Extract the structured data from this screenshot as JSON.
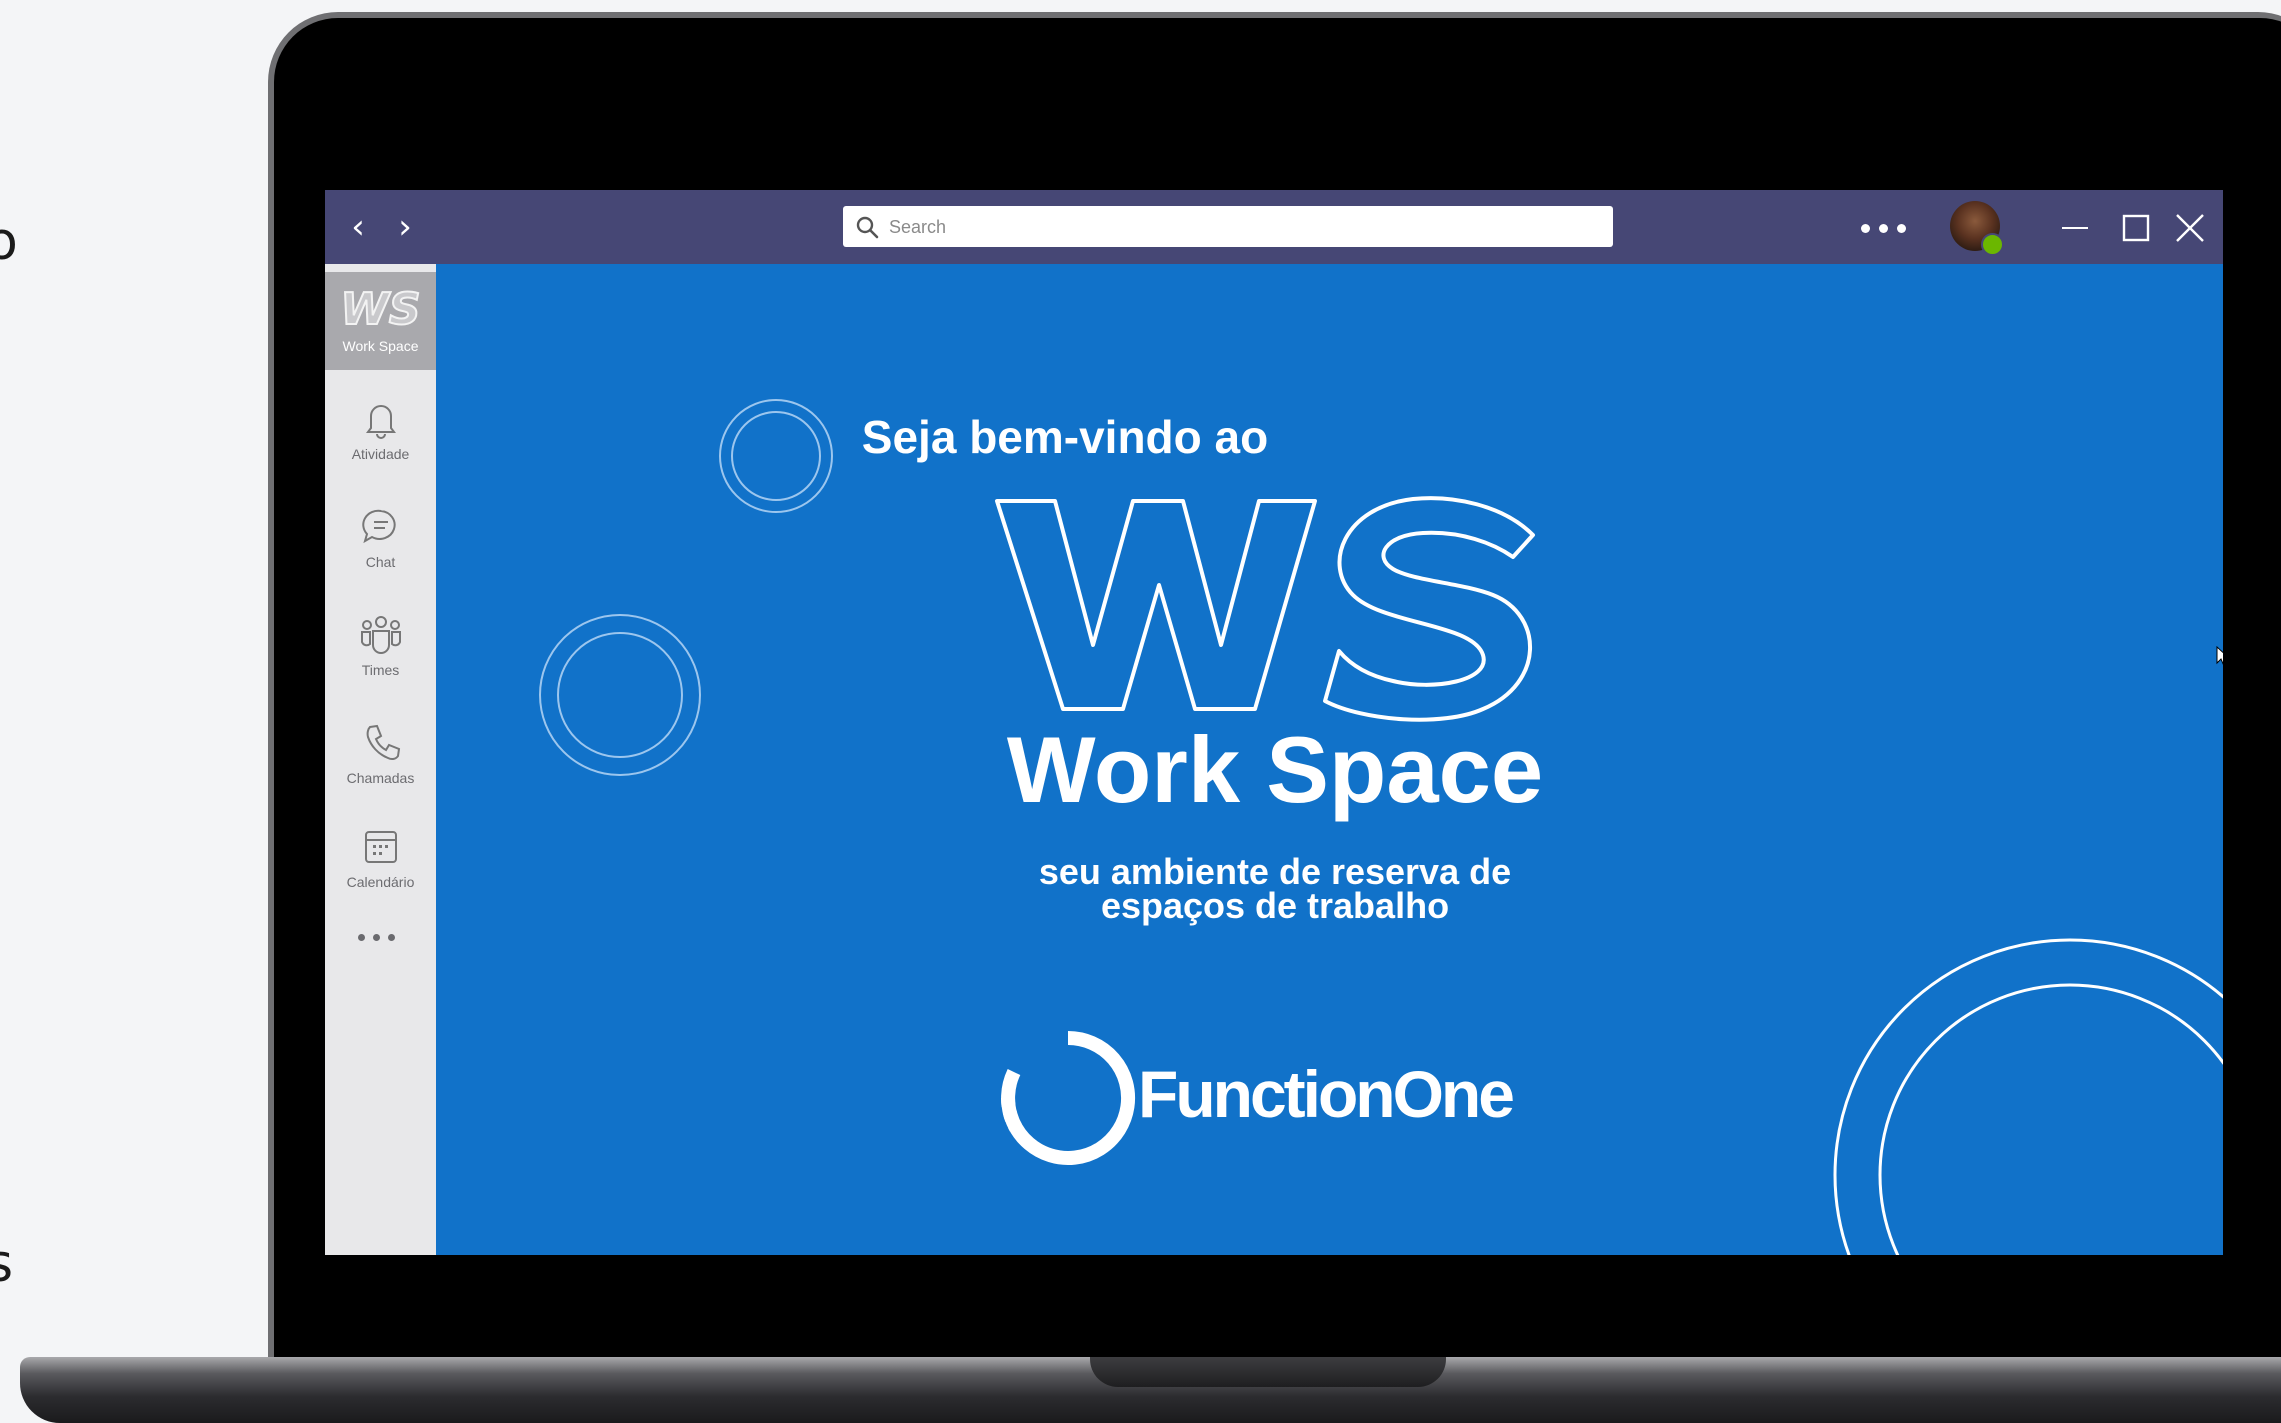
{
  "edge_text": {
    "top": "o",
    "bottom": "s"
  },
  "window": {
    "nav_back": "‹",
    "nav_forward": "›",
    "search_placeholder": "Search",
    "more_icon": "more-horizontal-icon",
    "presence_status": "available",
    "presence_color": "#6bb700",
    "titlebar_color": "#464775"
  },
  "rail": {
    "brand": {
      "logo": "WS",
      "label": "Work Space"
    },
    "items": [
      {
        "label": "Atividade",
        "icon": "bell-icon"
      },
      {
        "label": "Chat",
        "icon": "chat-icon"
      },
      {
        "label": "Times",
        "icon": "teams-icon"
      },
      {
        "label": "Chamadas",
        "icon": "phone-icon"
      },
      {
        "label": "Calendário",
        "icon": "calendar-icon"
      }
    ],
    "more_icon": "more-horizontal-icon"
  },
  "welcome": {
    "heading": "Seja bem-vindo ao",
    "logo": "WS",
    "product_name": "Work Space",
    "tagline_line1": "seu ambiente de reserva de",
    "tagline_line2": "espaços de trabalho",
    "company": "FunctionOne",
    "background_color": "#1172c9"
  }
}
